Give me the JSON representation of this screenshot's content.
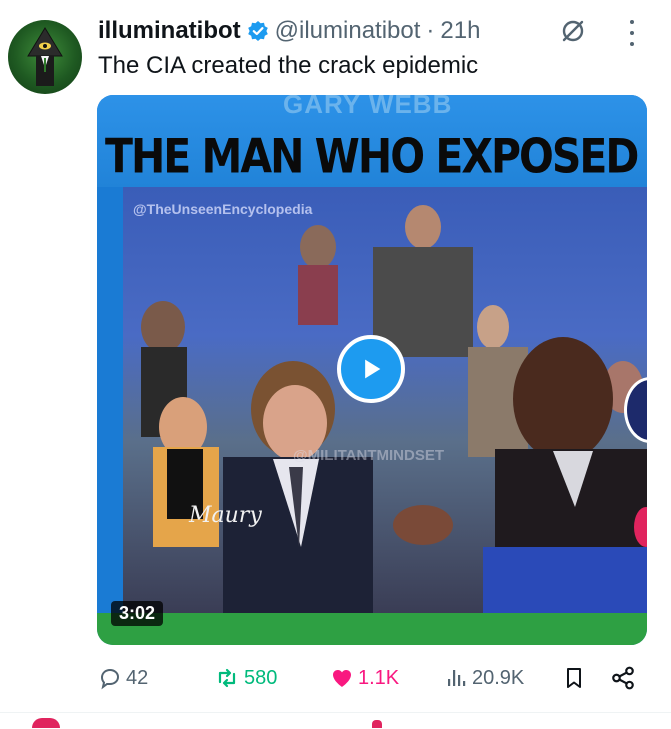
{
  "tweet": {
    "author_name": "illuminatibot",
    "handle": "@iluminatibot",
    "separator": "·",
    "time": "21h",
    "text": "The CIA created the crack epidemic",
    "icons": {
      "avatar": "illuminati-eye-avatar",
      "verified": "verified-badge-icon",
      "grok": "grok-icon",
      "more": "more-icon"
    }
  },
  "media": {
    "banner_subtitle": "GARY WEBB",
    "banner_title": "THE MAN WHO EXPOSED THE C",
    "watermark_top": "@TheUnseenEncyclopedia",
    "watermark_mid": "@MILITANTMINDSET",
    "logo_text": "Maury",
    "duration": "3:02"
  },
  "actions": {
    "replies": "42",
    "reposts": "580",
    "likes": "1.1K",
    "views": "20.9K"
  },
  "colors": {
    "accent": "#1d9bf0",
    "repost": "#00ba7c",
    "like": "#f91880",
    "muted": "#536471"
  }
}
